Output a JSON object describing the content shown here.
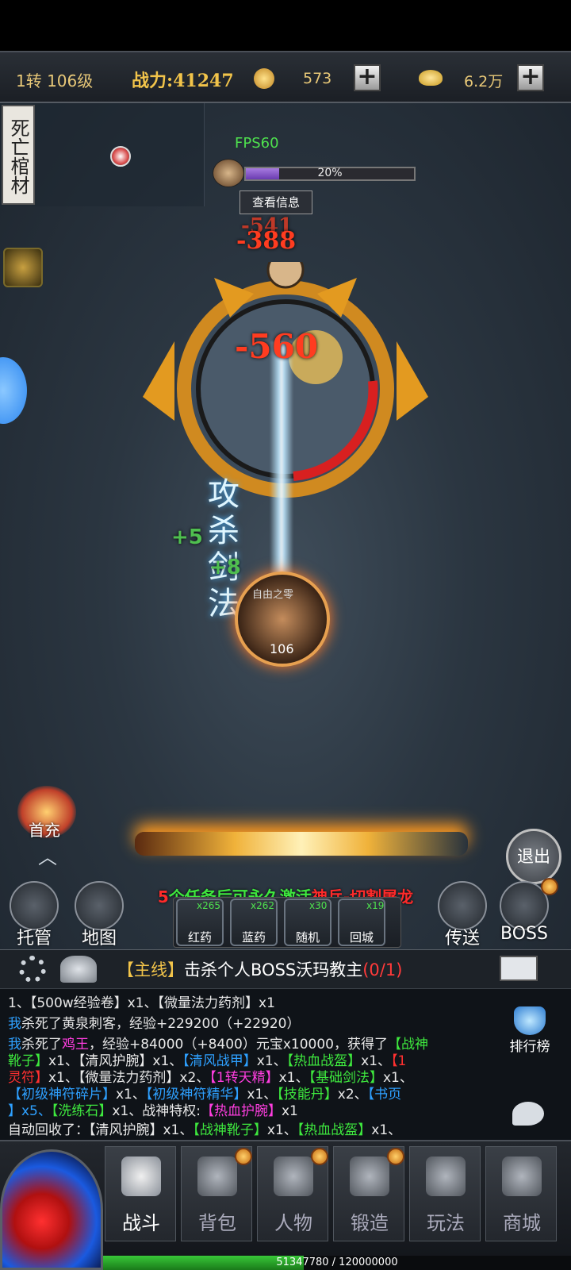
{
  "topbar": {
    "level": "1转 106级",
    "power_label": "战力:",
    "power_value": "41247",
    "coin": "573",
    "ingot": "6.2万"
  },
  "map": {
    "name": "死亡棺材"
  },
  "boss": {
    "fps": "FPS60",
    "hp_percent": 20,
    "hp_label": "20%",
    "info_button": "查看信息"
  },
  "damage": {
    "d1": "-541",
    "d2": "-388",
    "d3": "-560"
  },
  "heals": {
    "h1": "+5",
    "h2": "+8"
  },
  "skill": {
    "name": "攻杀剑法"
  },
  "player": {
    "name": "自由之零",
    "level": "106"
  },
  "first_recharge": "首充",
  "exit": "退出",
  "quest_tip": {
    "p1": "5",
    "p2": "个任务后可永久激活",
    "p3": "神兵-切割屠龙"
  },
  "functions": {
    "auto": "托管",
    "map": "地图",
    "teleport": "传送",
    "boss": "BOSS"
  },
  "items": [
    {
      "label": "红药",
      "count": "x265"
    },
    {
      "label": "蓝药",
      "count": "x262"
    },
    {
      "label": "随机",
      "count": "x30"
    },
    {
      "label": "回城",
      "count": "x19"
    }
  ],
  "quest": {
    "tag": "【主线】",
    "text": "击杀个人BOSS沃玛教主",
    "progress": "(0/1)"
  },
  "chat": {
    "l1": "1、【500w经验卷】x1、【微量法力药剂】x1",
    "l2a": "我",
    "l2b": "杀死了黄泉刺客，经验+229200（+22920）",
    "l3a": "我",
    "l3b": "杀死了",
    "l3c": "鸡王",
    "l3d": "，经验+84000（+8400）元宝x10000，获得了",
    "l3e": "【战神",
    "l4a": "靴子】",
    "l4b": "x1、",
    "l4c": "【清风护腕】",
    "l4d": "x1、",
    "l4e": "【清风战甲】",
    "l4f": "x1、",
    "l4g": "【热血战盔】",
    "l4h": "x1、",
    "l4i": "【1",
    "l5a": "灵符】",
    "l5b": "x1、",
    "l5c": "【微量法力药剂】",
    "l5d": "x2、",
    "l5e": "【1转天精】",
    "l5f": "x1、",
    "l5g": "【基础剑法】",
    "l5h": "x1、",
    "l6a": "【初级神符碎片】",
    "l6b": "x1、",
    "l6c": "【初级神符精华】",
    "l6d": "x1、",
    "l6e": "【技能丹】",
    "l6f": "x2、",
    "l6g": "【书页",
    "l7a": "】x5、",
    "l7b": "【洗练石】",
    "l7c": "x1、战神特权:",
    "l7d": "【热血护腕】",
    "l7e": "x1",
    "l8a": "自动回收了：【清风护腕】x1、",
    "l8b": "【战神靴子】",
    "l8c": "x1、",
    "l8d": "【热血战盔】",
    "l8e": "x1、"
  },
  "rank": "排行榜",
  "nav": {
    "tabs": [
      "战斗",
      "背包",
      "人物",
      "锻造",
      "玩法",
      "商城"
    ],
    "exp_percent": 42.8,
    "exp_text": "51347780 / 120000000"
  }
}
